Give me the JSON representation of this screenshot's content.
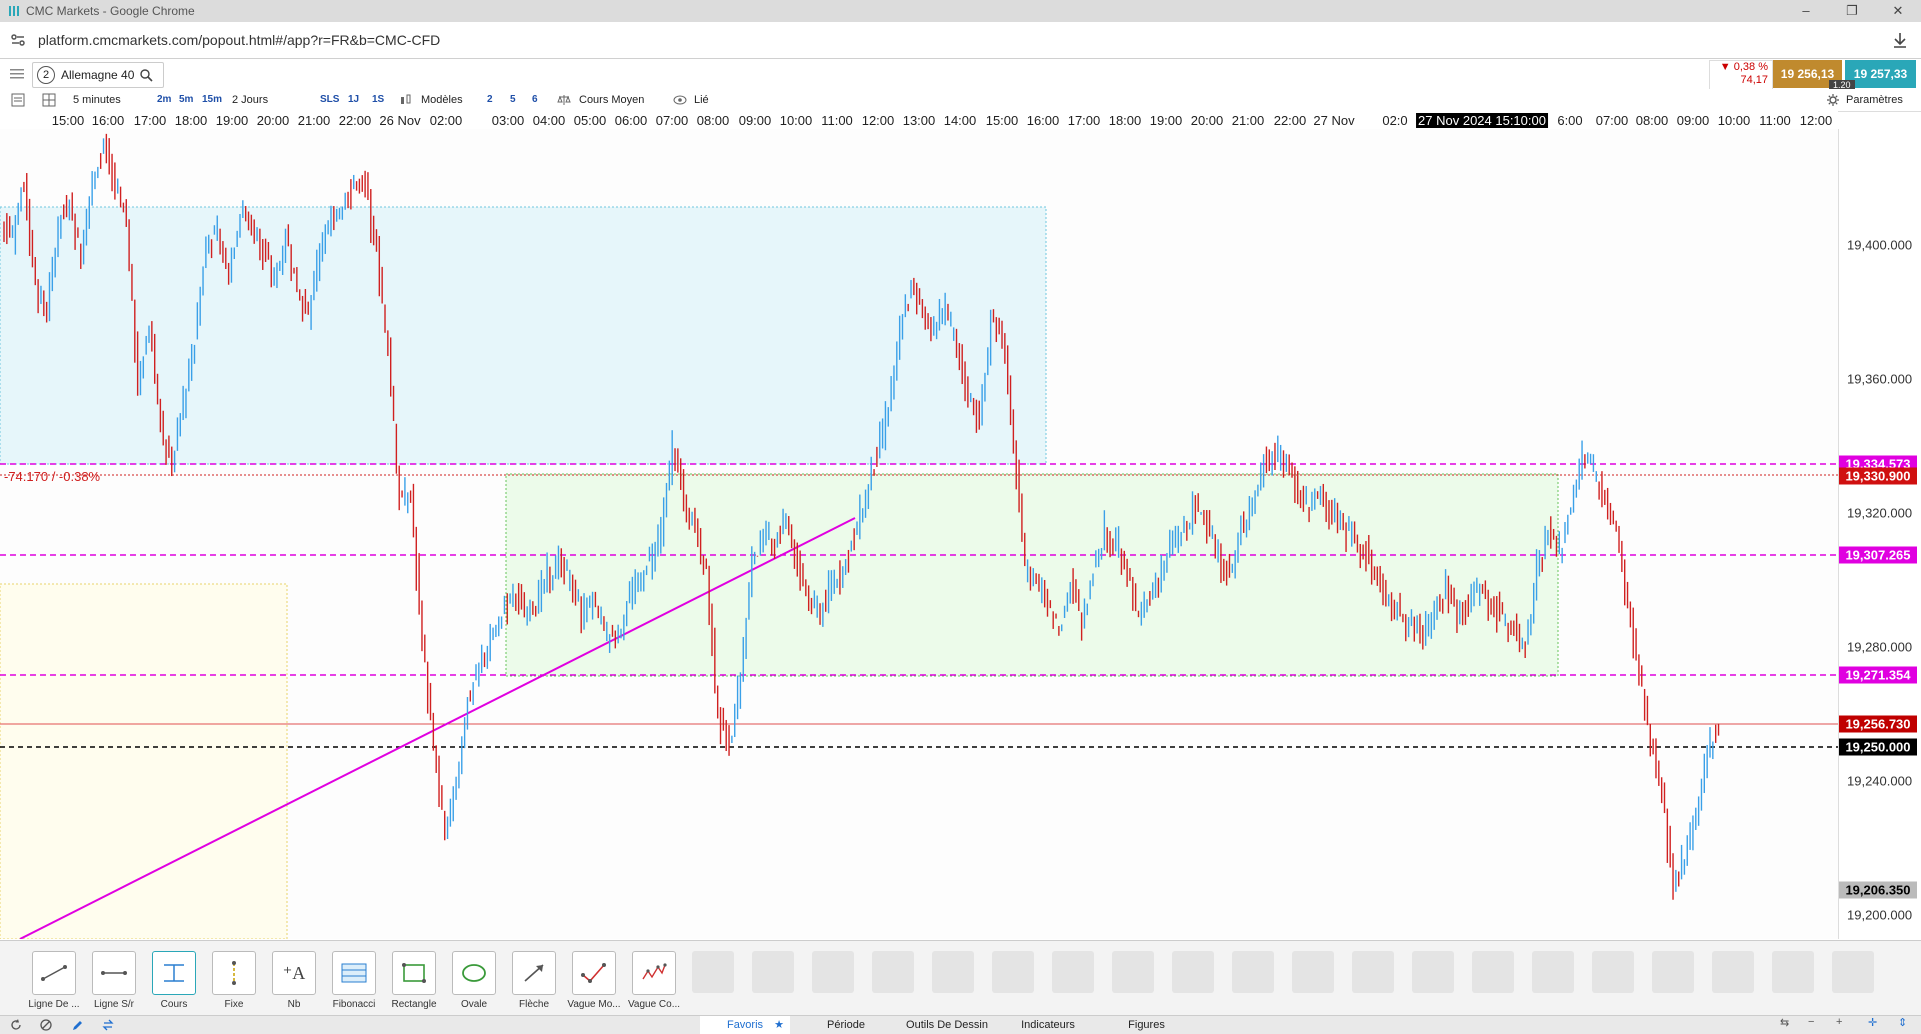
{
  "window": {
    "title": "CMC Markets - Google Chrome",
    "controls": [
      "–",
      "❐",
      "✕"
    ]
  },
  "browser": {
    "url": "platform.cmcmarkets.com/popout.html#/app?r=FR&b=CMC-CFD"
  },
  "instrument": {
    "index": "2",
    "name": "Allemagne 40"
  },
  "quote": {
    "change_pct": "▼ 0,38 %",
    "change_pts": "74,17",
    "sell": "19 256,13",
    "buy": "19 257,33",
    "spread": "1.20",
    "colors": {
      "sell": "#c08a2e",
      "buy": "#2aa7b8",
      "down": "#cc0000"
    }
  },
  "toolbar": {
    "interval": "5 minutes",
    "quick_intervals": [
      "2m",
      "5m",
      "15m"
    ],
    "range": "2 Jours",
    "quick_ranges": [
      "SLS",
      "1J",
      "1S"
    ],
    "models": "Modèles",
    "models_quick": [
      "2",
      "5",
      "6"
    ],
    "price_type": "Cours Moyen",
    "link": "Lié",
    "settings": "Paramètres"
  },
  "time_axis": {
    "labels": [
      "15:00",
      "16:00",
      "17:00",
      "18:00",
      "19:00",
      "20:00",
      "21:00",
      "22:00",
      "26 Nov",
      "02:00",
      "03:00",
      "04:00",
      "05:00",
      "06:00",
      "07:00",
      "08:00",
      "09:00",
      "10:00",
      "11:00",
      "12:00",
      "13:00",
      "14:00",
      "15:00",
      "16:00",
      "17:00",
      "18:00",
      "19:00",
      "20:00",
      "21:00",
      "22:00",
      "27 Nov",
      "02:0",
      "6:00",
      "07:00",
      "08:00",
      "09:00",
      "10:00",
      "11:00",
      "12:00"
    ],
    "crosshair": "27 Nov 2024 15:10:00"
  },
  "price_axis": {
    "labels": [
      "19,400.000",
      "19,360.000",
      "19,320.000",
      "19,280.000",
      "19,240.000",
      "19,200.000"
    ],
    "tags": {
      "level_top": "19,334.573",
      "last": "19,330.900",
      "level_mid": "19,307.265",
      "level_low": "19,271.354",
      "current": "19,256.730",
      "round": "19,250.000",
      "low": "19,206.350"
    }
  },
  "chart_info": {
    "change_label": "-74.170 / -0.38%"
  },
  "chart_data": {
    "type": "candlestick",
    "interval": "5 minutes",
    "ylim": [
      19195,
      19425
    ],
    "ticks": [
      19200,
      19240,
      19280,
      19320,
      19360,
      19400
    ],
    "close_series": [
      19395,
      19410,
      19380,
      19372,
      19398,
      19405,
      19388,
      19412,
      19420,
      19408,
      19398,
      19352,
      19370,
      19340,
      19330,
      19348,
      19365,
      19392,
      19395,
      19385,
      19402,
      19398,
      19390,
      19382,
      19395,
      19380,
      19370,
      19392,
      19398,
      19404,
      19410,
      19408,
      19390,
      19362,
      19320,
      19320,
      19280,
      19248,
      19225,
      19238,
      19262,
      19272,
      19280,
      19286,
      19294,
      19288,
      19290,
      19298,
      19302,
      19298,
      19288,
      19290,
      19282,
      19280,
      19290,
      19296,
      19302,
      19310,
      19335,
      19320,
      19312,
      19298,
      19258,
      19250,
      19270,
      19302,
      19310,
      19308,
      19315,
      19302,
      19290,
      19288,
      19296,
      19300,
      19310,
      19320,
      19333,
      19345,
      19368,
      19380,
      19372,
      19368,
      19375,
      19362,
      19350,
      19342,
      19370,
      19368,
      19335,
      19300,
      19298,
      19290,
      19282,
      19296,
      19284,
      19300,
      19310,
      19308,
      19298,
      19286,
      19292,
      19300,
      19308,
      19310,
      19318,
      19314,
      19302,
      19298,
      19312,
      19320,
      19330,
      19332,
      19330,
      19322,
      19318,
      19322,
      19316,
      19312,
      19310,
      19304,
      19298,
      19290,
      19288,
      19284,
      19282,
      19288,
      19294,
      19288,
      19290,
      19296,
      19290,
      19286,
      19282,
      19278,
      19300,
      19310,
      19305,
      19318,
      19334,
      19328,
      19320,
      19310,
      19290,
      19270,
      19252,
      19235,
      19210,
      19220,
      19230,
      19248,
      19256
    ]
  }
}
